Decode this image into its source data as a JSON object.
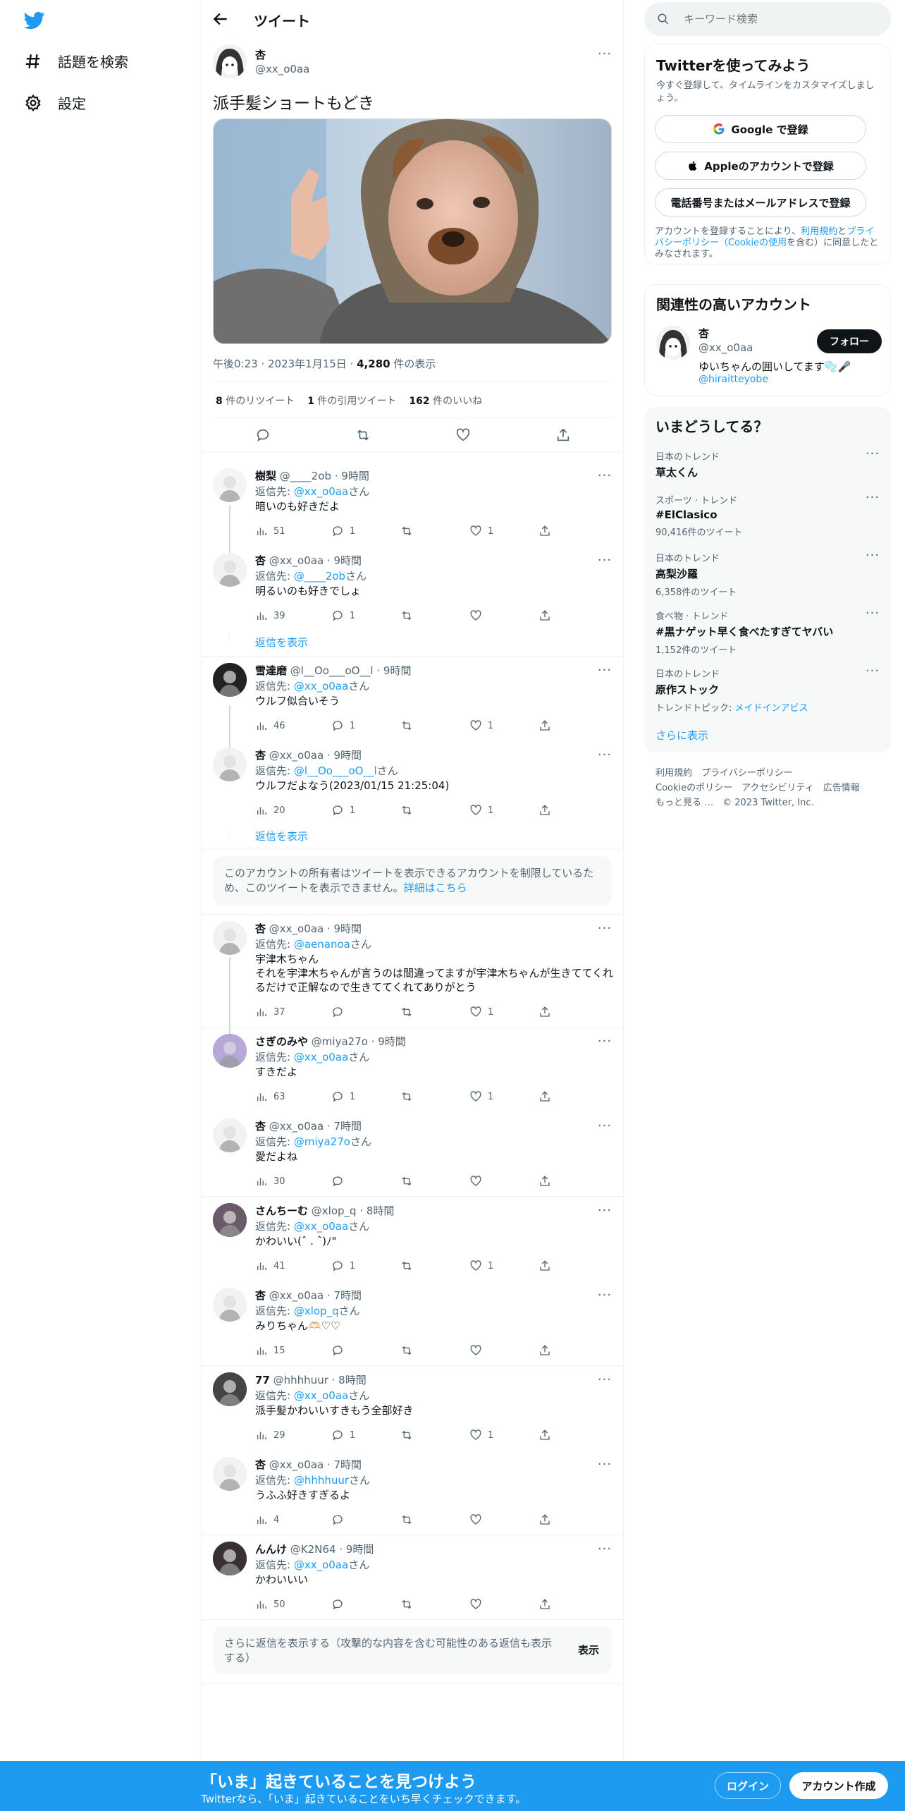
{
  "nav": {
    "explore_label": "話題を検索",
    "settings_label": "設定"
  },
  "header": {
    "title": "ツイート"
  },
  "tweet": {
    "name": "杏",
    "handle": "@xx_o0aa",
    "text": "派手髪ショートもどき",
    "time": "午後0:23",
    "date": "2023年1月15日",
    "views": "4,280",
    "views_label": "件の表示",
    "retweets": "8",
    "retweets_label": "件のリツイート",
    "quotes": "1",
    "quotes_label": "件の引用ツイート",
    "likes": "162",
    "likes_label": "件のいいね"
  },
  "replies": [
    {
      "name": "樹梨",
      "handle": "@____2ob · 9時間",
      "to_prefix": "返信先: ",
      "to": "@xx_o0aa",
      "to_suffix": "さん",
      "text": "暗いのも好きだよ",
      "views": "51",
      "replies": "1",
      "retweets": "",
      "likes": "1"
    },
    {
      "name": "杏",
      "handle": "@xx_o0aa · 9時間",
      "to_prefix": "返信先: ",
      "to": "@____2ob",
      "to_suffix": "さん",
      "text": "明るいのも好きでしょ",
      "views": "39",
      "replies": "1",
      "retweets": "",
      "likes": ""
    },
    {
      "name": "雪達磨",
      "handle": "@l__Oo___oO__l · 9時間",
      "to_prefix": "返信先: ",
      "to": "@xx_o0aa",
      "to_suffix": "さん",
      "text": "ウルフ似合いそう",
      "views": "46",
      "replies": "1",
      "retweets": "",
      "likes": "1"
    },
    {
      "name": "杏",
      "handle": "@xx_o0aa · 9時間",
      "to_prefix": "返信先: ",
      "to": "@l__Oo___oO__l",
      "to_suffix": "さん",
      "text": "ウルフだよなう(2023/01/15 21:25:04)",
      "views": "20",
      "replies": "1",
      "retweets": "",
      "likes": "1"
    },
    {
      "name": "杏",
      "handle": "@xx_o0aa · 9時間",
      "to_prefix": "返信先: ",
      "to": "@aenanoa",
      "to_suffix": "さん",
      "text": "宇津木ちゃん\nそれを宇津木ちゃんが言うのは間違ってますが宇津木ちゃんが生きててくれるだけで正解なので生きててくれてありがとう",
      "views": "37",
      "replies": "",
      "retweets": "",
      "likes": "1"
    },
    {
      "name": "さぎのみや",
      "handle": "@miya27o · 9時間",
      "to_prefix": "返信先: ",
      "to": "@xx_o0aa",
      "to_suffix": "さん",
      "text": "すきだよ",
      "views": "63",
      "replies": "1",
      "retweets": "",
      "likes": "1"
    },
    {
      "name": "杏",
      "handle": "@xx_o0aa · 7時間",
      "to_prefix": "返信先: ",
      "to": "@miya27o",
      "to_suffix": "さん",
      "text": "愛だよね",
      "views": "30",
      "replies": "",
      "retweets": "",
      "likes": ""
    },
    {
      "name": "さんちーむ",
      "handle": "@xlop_q · 8時間",
      "to_prefix": "返信先: ",
      "to": "@xx_o0aa",
      "to_suffix": "さん",
      "text": "かわいい(ˆ . ˆ)ﾉ\"",
      "views": "41",
      "replies": "1",
      "retweets": "",
      "likes": "1"
    },
    {
      "name": "杏",
      "handle": "@xx_o0aa · 7時間",
      "to_prefix": "返信先: ",
      "to": "@xlop_q",
      "to_suffix": "さん",
      "text": "みりちゃん🫶🏻♡♡",
      "views": "15",
      "replies": "",
      "retweets": "",
      "likes": ""
    },
    {
      "name": "77",
      "handle": "@hhhhuur · 8時間",
      "to_prefix": "返信先: ",
      "to": "@xx_o0aa",
      "to_suffix": "さん",
      "text": "派手髪かわいいすきもう全部好き",
      "views": "29",
      "replies": "1",
      "retweets": "",
      "likes": "1"
    },
    {
      "name": "杏",
      "handle": "@xx_o0aa · 7時間",
      "to_prefix": "返信先: ",
      "to": "@hhhhuur",
      "to_suffix": "さん",
      "text": "うふふ好きすぎるよ",
      "views": "4",
      "replies": "",
      "retweets": "",
      "likes": ""
    },
    {
      "name": "んんけ",
      "handle": "@K2N64 · 9時間",
      "to_prefix": "返信先: ",
      "to": "@xx_o0aa",
      "to_suffix": "さん",
      "text": "かわいいい",
      "views": "50",
      "replies": "",
      "retweets": "",
      "likes": ""
    }
  ],
  "show_replies_label": "返信を表示",
  "restricted": {
    "text": "このアカウントの所有者はツイートを表示できるアカウントを制限しているため、このツイートを表示できません。",
    "link": "詳細はこちら"
  },
  "more_replies": {
    "text": "さらに返信を表示する（攻撃的な内容を含む可能性のある返信も表示する）",
    "button": "表示"
  },
  "search": {
    "placeholder": "キーワード検索"
  },
  "signup_card": {
    "title": "Twitterを使ってみよう",
    "subtitle": "今すぐ登録して、タイムラインをカスタマイズしましょう。",
    "google": "Google で登録",
    "apple": "Appleのアカウントで登録",
    "phone": "電話番号またはメールアドレスで登録",
    "legal_1": "アカウントを登録することにより、",
    "legal_terms": "利用規約",
    "legal_2": "と",
    "legal_privacy": "プライバシーポリシー（Cookieの使用",
    "legal_3": "を含む）に同意したとみなされます。"
  },
  "relevant": {
    "title": "関連性の高いアカウント",
    "name": "杏",
    "handle": "@xx_o0aa",
    "follow": "フォロー",
    "bio": "ゆいちゃんの囲いしてます🫧🎤",
    "bio_link": "@hiraitteyobe"
  },
  "trends": {
    "title": "いまどうしてる？",
    "items": [
      {
        "cat": "日本のトレンド",
        "name": "草太くん",
        "count": ""
      },
      {
        "cat": "スポーツ · トレンド",
        "name": "#ElClasico",
        "count": "90,416件のツイート"
      },
      {
        "cat": "日本のトレンド",
        "name": "高梨沙羅",
        "count": "6,358件のツイート"
      },
      {
        "cat": "食べ物 · トレンド",
        "name": "#黒ナゲット早く食べたすぎてヤバい",
        "count": "1,152件のツイート"
      },
      {
        "cat": "日本のトレンド",
        "name": "原作ストック",
        "count": "トレンドトピック: ",
        "count_link": "メイドインアビス"
      }
    ],
    "show_more": "さらに表示"
  },
  "footer": {
    "line1": "利用規約　プライバシーポリシー",
    "line2": "Cookieのポリシー　アクセシビリティ　広告情報",
    "line3": "もっと見る …　© 2023 Twitter, Inc."
  },
  "banner": {
    "title": "「いま」起きていることを見つけよう",
    "subtitle": "Twitterなら、「いま」起きていることをいち早くチェックできます。",
    "login": "ログイン",
    "signup": "アカウント作成"
  },
  "colors": {
    "accent": "#1d9bf0",
    "text": "#0f1419",
    "muted": "#536471"
  }
}
